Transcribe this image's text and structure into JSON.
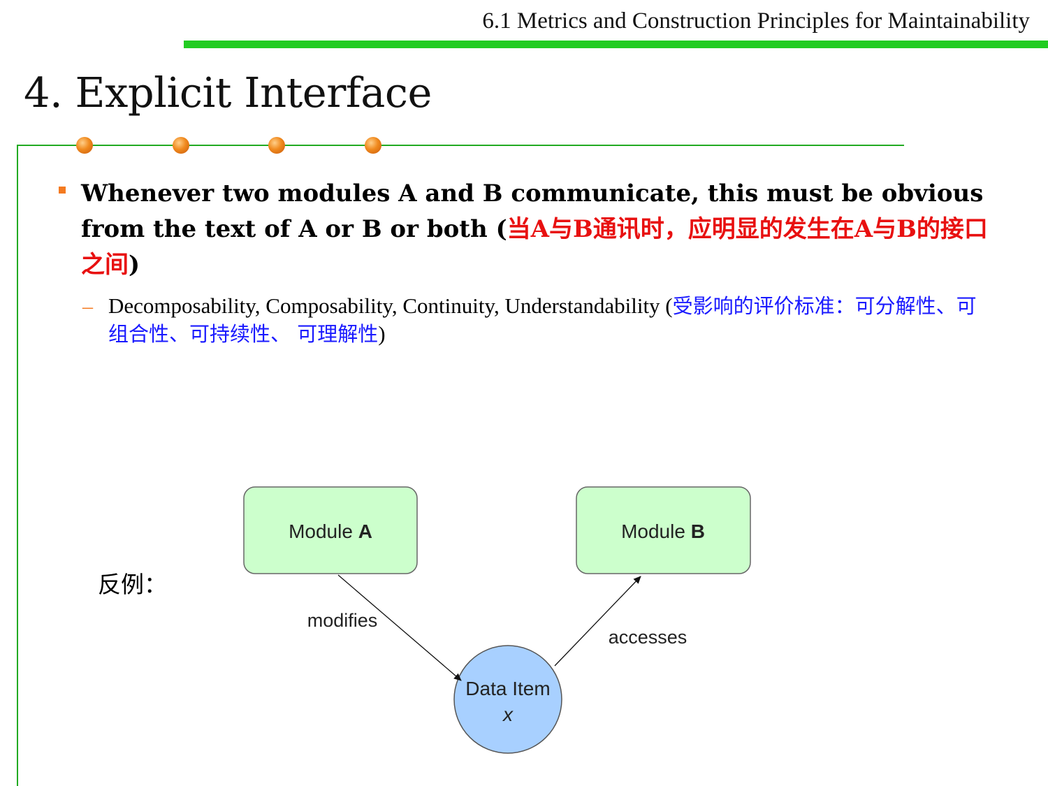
{
  "header": {
    "title": "6.1 Metrics and Construction Principles for Maintainability",
    "rule_color": "#22cc22"
  },
  "slide": {
    "title": "4. Explicit Interface",
    "frame_color": "#22aa22",
    "dot_color": "#f08a1e"
  },
  "bullet": {
    "marker_color": "#f47a20",
    "text_en": "Whenever two modules A and B communicate, this must be obvious from the text of A or B or both (",
    "text_cn": "当A与B通讯时，应明显的发生在A与B的接口之间",
    "text_close": ")",
    "highlight_color": "#e81010"
  },
  "sub_bullet": {
    "marker": "–",
    "marker_color": "#f47a20",
    "text_en": "Decomposability, Composability, Continuity, Understandability (",
    "text_cn": "受影响的评价标准：可分解性、可组合性、可持续性、 可理解性",
    "text_close": ")",
    "highlight_color": "#1a1aff"
  },
  "counter_example_label": "反例：",
  "diagram": {
    "module_a": {
      "prefix": "Module ",
      "name": "A"
    },
    "module_b": {
      "prefix": "Module ",
      "name": "B"
    },
    "data_item": {
      "line1": "Data Item",
      "line2": "x"
    },
    "edge_modifies": "modifies",
    "edge_accesses": "accesses",
    "module_fill": "#ccffcc",
    "data_fill": "#a8d0ff"
  }
}
